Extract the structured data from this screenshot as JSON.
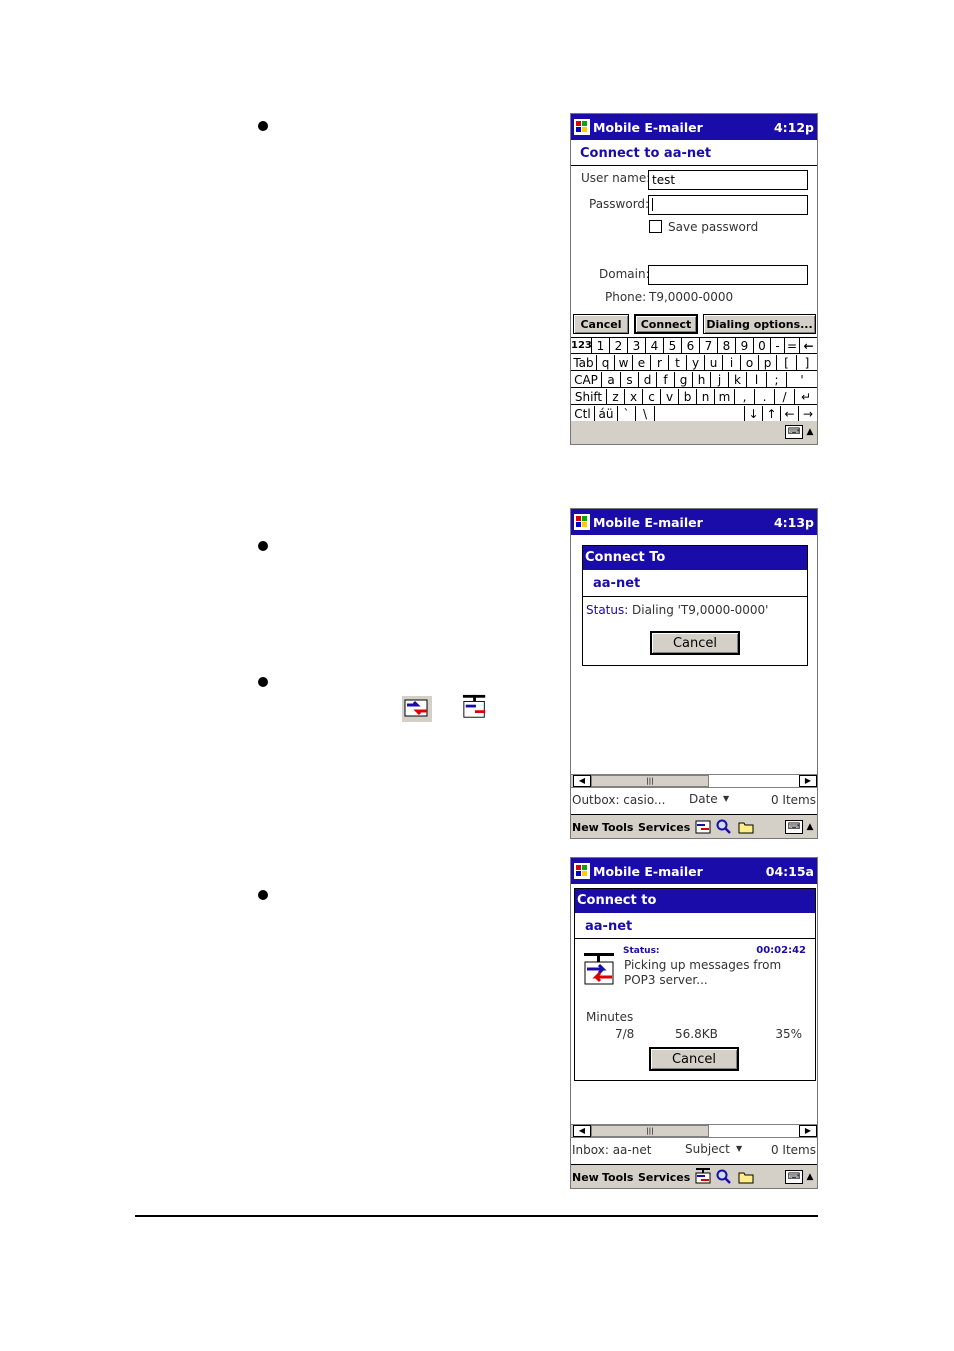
{
  "screen1": {
    "app": "Mobile E-mailer",
    "time": "4:12p",
    "heading": "Connect to aa-net",
    "username_label": "User name:",
    "username_value": "test",
    "password_label": "Password:",
    "save_password_label": "Save password",
    "domain_label": "Domain:",
    "phone_label": "Phone:",
    "phone_value": "T9,0000-0000",
    "cancel": "Cancel",
    "connect": "Connect",
    "dialing_options": "Dialing options...",
    "keyboard_rows": [
      [
        "123",
        "1",
        "2",
        "3",
        "4",
        "5",
        "6",
        "7",
        "8",
        "9",
        "0",
        "-",
        "=",
        "←"
      ],
      [
        "Tab",
        "q",
        "w",
        "e",
        "r",
        "t",
        "y",
        "u",
        "i",
        "o",
        "p",
        "[",
        "]"
      ],
      [
        "CAP",
        "a",
        "s",
        "d",
        "f",
        "g",
        "h",
        "j",
        "k",
        "l",
        ";",
        "'"
      ],
      [
        "Shift",
        "z",
        "x",
        "c",
        "v",
        "b",
        "n",
        "m",
        ",",
        ".",
        "/",
        "↵"
      ],
      [
        "Ctl",
        "áü",
        "`",
        "\\",
        "",
        "↓",
        "↑",
        "←",
        "→"
      ]
    ]
  },
  "screen2": {
    "app": "Mobile E-mailer",
    "time": "4:13p",
    "dialog_title": "Connect To",
    "dialog_name": "aa-net",
    "status_label": "Status:",
    "status_value": "Dialing 'T9,0000-0000'",
    "cancel": "Cancel",
    "folder": "Outbox: casio...",
    "sort": "Date",
    "items": "0 Items",
    "menu": [
      "New",
      "Tools",
      "Services"
    ]
  },
  "screen3": {
    "app": "Mobile E-mailer",
    "time": "04:15a",
    "dialog_title": "Connect to",
    "dialog_name": "aa-net",
    "status_label": "Status:",
    "elapsed": "00:02:42",
    "status_line1": "Picking up messages from",
    "status_line2": "POP3 server...",
    "minutes_label": "Minutes",
    "count": "7/8",
    "size": "56.8KB",
    "percent": "35%",
    "progress_fraction": 0.35,
    "cancel": "Cancel",
    "folder": "Inbox: aa-net",
    "sort": "Subject",
    "items": "0 Items",
    "menu": [
      "New",
      "Tools",
      "Services"
    ]
  },
  "colors": {
    "title_blue": "#1a0ca8",
    "chrome_gray": "#d4d0c8"
  }
}
